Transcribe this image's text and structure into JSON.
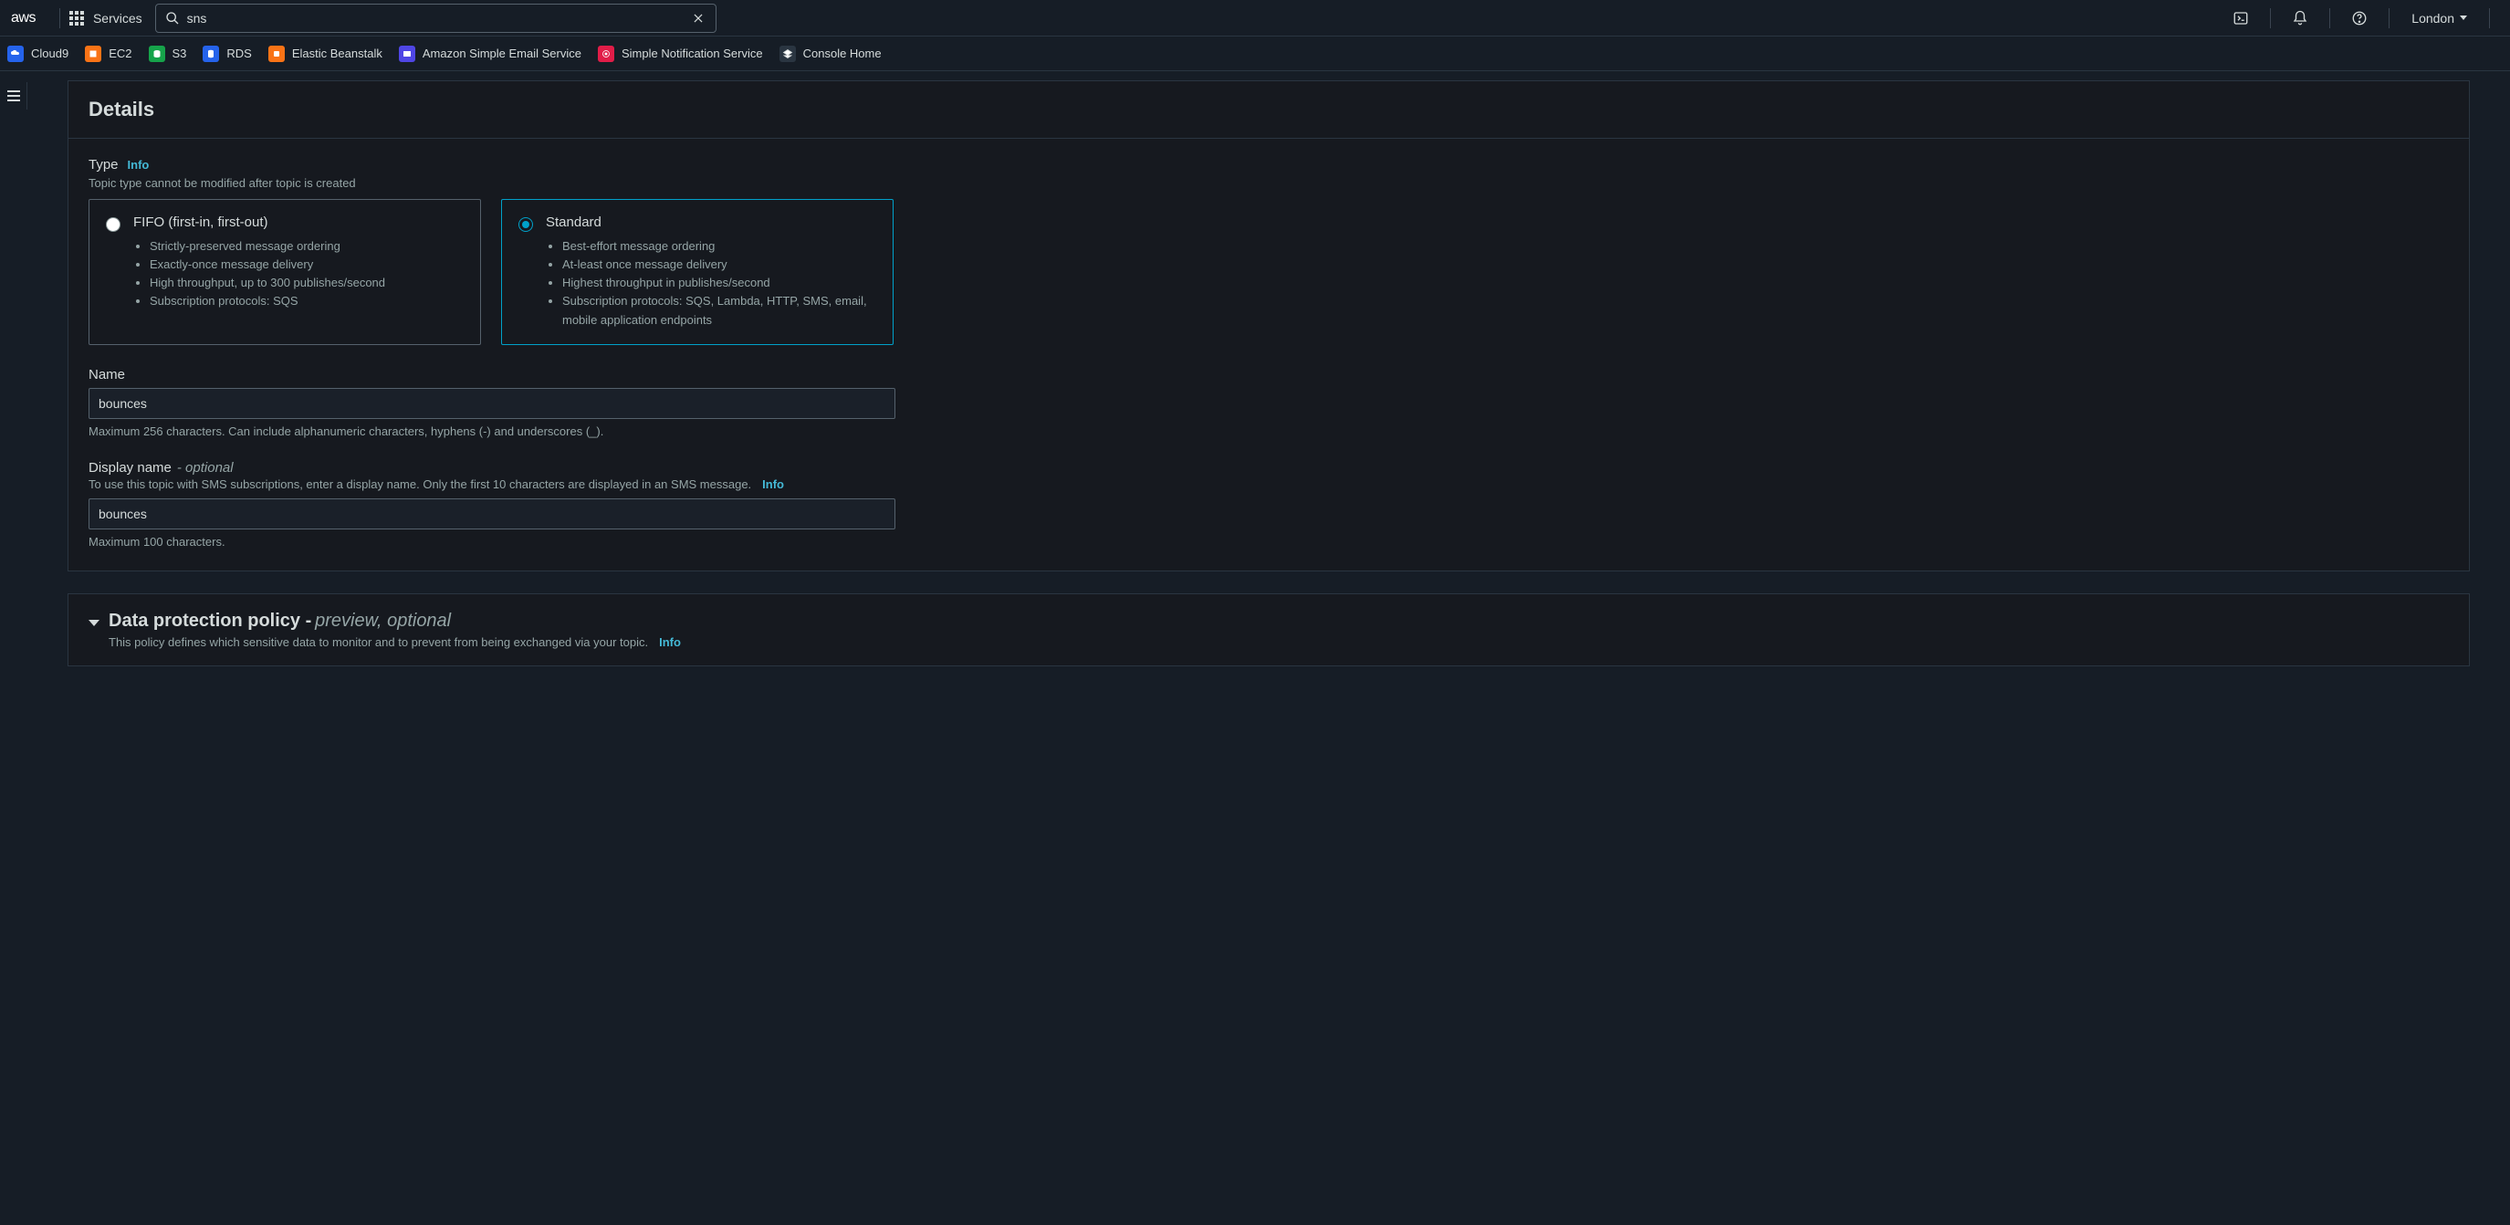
{
  "topnav": {
    "logo_text": "aws",
    "services_label": "Services",
    "search_value": "sns",
    "region": "London"
  },
  "favorites": [
    {
      "label": "Cloud9",
      "color": "#2563eb"
    },
    {
      "label": "EC2",
      "color": "#f97316"
    },
    {
      "label": "S3",
      "color": "#16a34a"
    },
    {
      "label": "RDS",
      "color": "#2563eb"
    },
    {
      "label": "Elastic Beanstalk",
      "color": "#f97316"
    },
    {
      "label": "Amazon Simple Email Service",
      "color": "#4f46e5"
    },
    {
      "label": "Simple Notification Service",
      "color": "#e11d48"
    },
    {
      "label": "Console Home",
      "color": "#6b7280"
    }
  ],
  "details": {
    "panel_title": "Details",
    "type": {
      "label": "Type",
      "info": "Info",
      "desc": "Topic type cannot be modified after topic is created",
      "options": [
        {
          "title": "FIFO (first-in, first-out)",
          "selected": false,
          "bullets": [
            "Strictly-preserved message ordering",
            "Exactly-once message delivery",
            "High throughput, up to 300 publishes/second",
            "Subscription protocols: SQS"
          ]
        },
        {
          "title": "Standard",
          "selected": true,
          "bullets": [
            "Best-effort message ordering",
            "At-least once message delivery",
            "Highest throughput in publishes/second",
            "Subscription protocols: SQS, Lambda, HTTP, SMS, email, mobile application endpoints"
          ]
        }
      ]
    },
    "name": {
      "label": "Name",
      "value": "bounces",
      "hint": "Maximum 256 characters. Can include alphanumeric characters, hyphens (-) and underscores (_)."
    },
    "display_name": {
      "label": "Display name",
      "suffix": "- optional",
      "desc": "To use this topic with SMS subscriptions, enter a display name. Only the first 10 characters are displayed in an SMS message.",
      "info": "Info",
      "value": "bounces",
      "hint": "Maximum 100 characters."
    }
  },
  "data_protection": {
    "title": "Data protection policy -",
    "suffix": "preview, optional",
    "desc": "This policy defines which sensitive data to monitor and to prevent from being exchanged via your topic.",
    "info": "Info"
  }
}
